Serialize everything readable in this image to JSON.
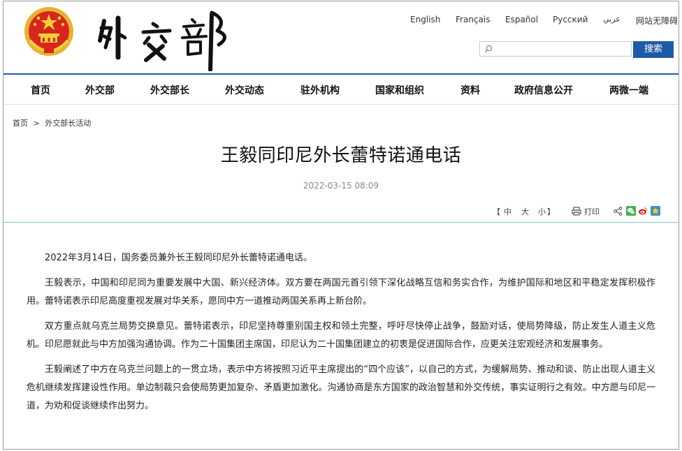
{
  "header": {
    "calligraphy_text": "外交部",
    "languages": [
      "English",
      "Français",
      "Español",
      "Русский",
      "عربي",
      "网站无障碍"
    ],
    "search": {
      "placeholder": "",
      "button_label": "搜索"
    }
  },
  "nav": {
    "items": [
      "首页",
      "外交部",
      "外交部长",
      "外交动态",
      "驻外机构",
      "国家和组织",
      "资料",
      "政府信息公开",
      "两微一端"
    ]
  },
  "breadcrumb": {
    "home": "首页",
    "separator": ">",
    "section": "外交部长活动"
  },
  "article": {
    "title": "王毅同印尼外长蕾特诺通电话",
    "date": "2022-03-15 08:09",
    "font_size": {
      "open": "【",
      "large": "中",
      "medium": "大",
      "small": "小",
      "close": "】"
    },
    "print_label": "打印",
    "share_icons": [
      "share-icon",
      "wechat-icon",
      "weibo-icon",
      "qzone-icon"
    ],
    "paragraphs": [
      "2022年3月14日，国务委员兼外长王毅同印尼外长蕾特诺通电话。",
      "王毅表示，中国和印尼同为重要发展中大国、新兴经济体。双方要在两国元首引领下深化战略互信和务实合作，为维护国际和地区和平稳定发挥积极作用。蕾特诺表示印尼高度重视发展对华关系，愿同中方一道推动两国关系再上新台阶。",
      "双方重点就乌克兰局势交换意见。蕾特诺表示，印尼坚持尊重别国主权和领土完整，呼吁尽快停止战争，鼓励对话，使局势降级，防止发生人道主义危机。印尼愿就此与中方加强沟通协调。作为二十国集团主席国，印尼认为二十国集团建立的初衷是促进国际合作，应更关注宏观经济和发展事务。",
      "王毅阐述了中方在乌克兰问题上的一贯立场，表示中方将按照习近平主席提出的“四个应该”，以自己的方式，为缓解局势、推动和谈、防止出现人道主义危机继续发挥建设性作用。单边制裁只会使局势更加复杂、矛盾更加激化。沟通协商是东方国家的政治智慧和外交传统，事实证明行之有效。中方愿与印尼一道，为劝和促谈继续作出努力。"
    ]
  },
  "colors": {
    "brand_blue": "#1f5aa6",
    "emblem_red": "#d7261e",
    "emblem_gold": "#e8b230",
    "rule_cyan": "#87c2d9"
  }
}
